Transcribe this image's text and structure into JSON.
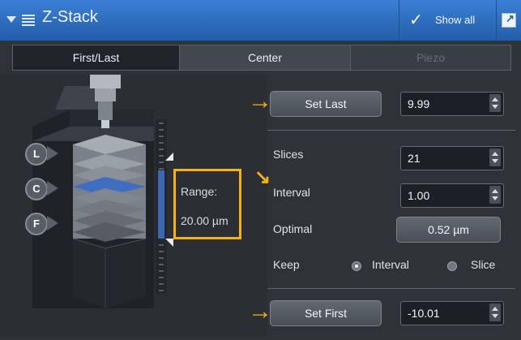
{
  "title": "Z-Stack",
  "show_all": "Show all",
  "tabs": [
    "First/Last",
    "Center",
    "Piezo"
  ],
  "buttons": {
    "set_last": "Set Last",
    "set_first": "Set First"
  },
  "values": {
    "last": "9.99",
    "slices": "21",
    "interval": "1.00",
    "optimal": "0.52 µm",
    "first": "-10.01"
  },
  "labels": {
    "slices": "Slices",
    "interval": "Interval",
    "optimal": "Optimal",
    "keep": "Keep",
    "keep_interval": "Interval",
    "keep_slice": "Slice",
    "range": "Range:",
    "range_value": "20.00 µm"
  },
  "markers": [
    "L",
    "C",
    "F"
  ],
  "colors": {
    "title_bar": "#2f6cc0",
    "accent": "#f6b20f",
    "background": "#2f3338"
  }
}
